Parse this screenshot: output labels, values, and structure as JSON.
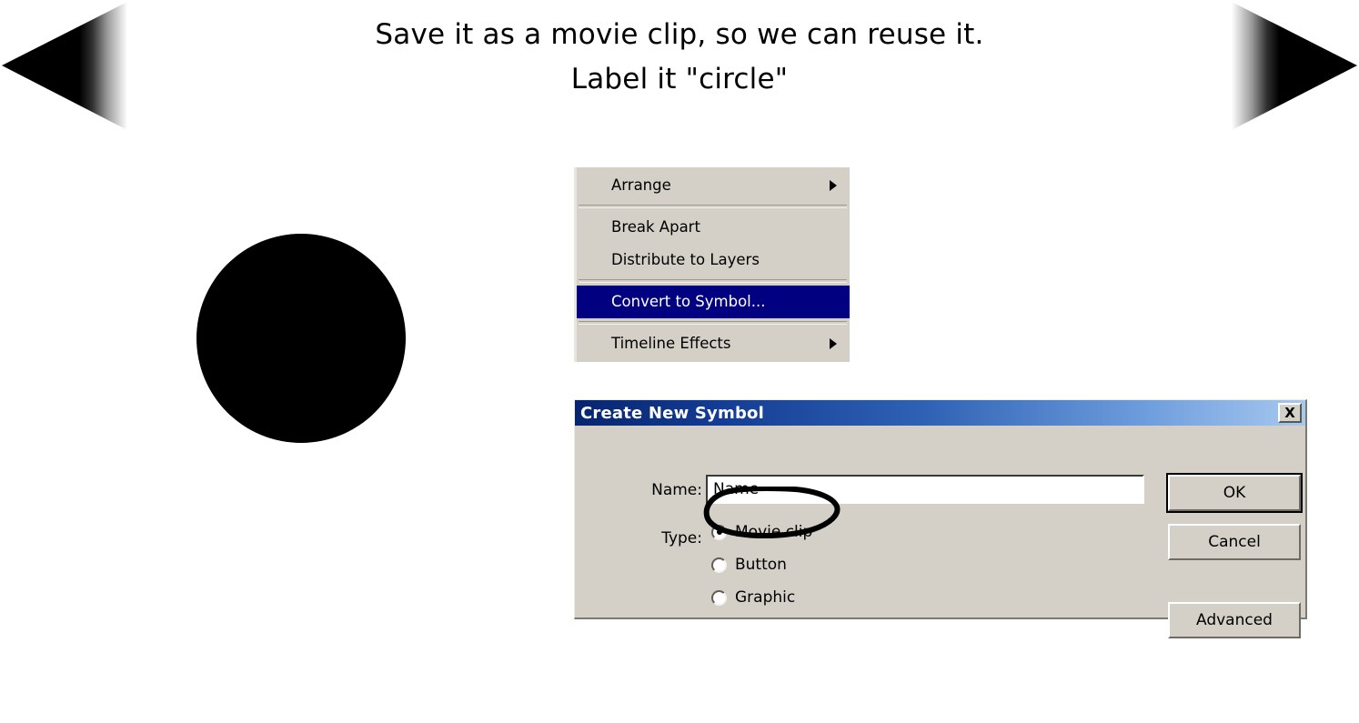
{
  "slide": {
    "heading_line1": "Save it as a movie clip, so we can reuse it.",
    "heading_line2": "Label it \"circle\"",
    "artwork_name": "black-circle",
    "artwork_color": "#000000"
  },
  "navigation": {
    "prev_label": "previous-slide-arrow",
    "next_label": "next-slide-arrow"
  },
  "context_menu": {
    "items": [
      {
        "label": "Arrange",
        "has_submenu": true,
        "selected": false
      },
      {
        "label": "Break Apart",
        "has_submenu": false,
        "selected": false
      },
      {
        "label": "Distribute to Layers",
        "has_submenu": false,
        "selected": false
      },
      {
        "label": "Convert to Symbol...",
        "has_submenu": false,
        "selected": true
      },
      {
        "label": "Timeline Effects",
        "has_submenu": true,
        "selected": false
      }
    ],
    "highlight_color": "#000080",
    "background_color": "#d4d0c8"
  },
  "dialog": {
    "title": "Create New Symbol",
    "close_label": "X",
    "name_label": "Name:",
    "name_value": "Name",
    "name_placeholder": "Name",
    "type_label": "Type:",
    "type_options": [
      {
        "label": "Movie clip",
        "checked": true
      },
      {
        "label": "Button",
        "checked": false
      },
      {
        "label": "Graphic",
        "checked": false
      }
    ],
    "buttons": {
      "ok": "OK",
      "cancel": "Cancel",
      "advanced": "Advanced"
    },
    "titlebar_color": "#123a92",
    "background_color": "#d4d0c8"
  },
  "annotation": {
    "target": "Movie clip",
    "shape": "hand-drawn-ellipse",
    "color": "#000000"
  }
}
